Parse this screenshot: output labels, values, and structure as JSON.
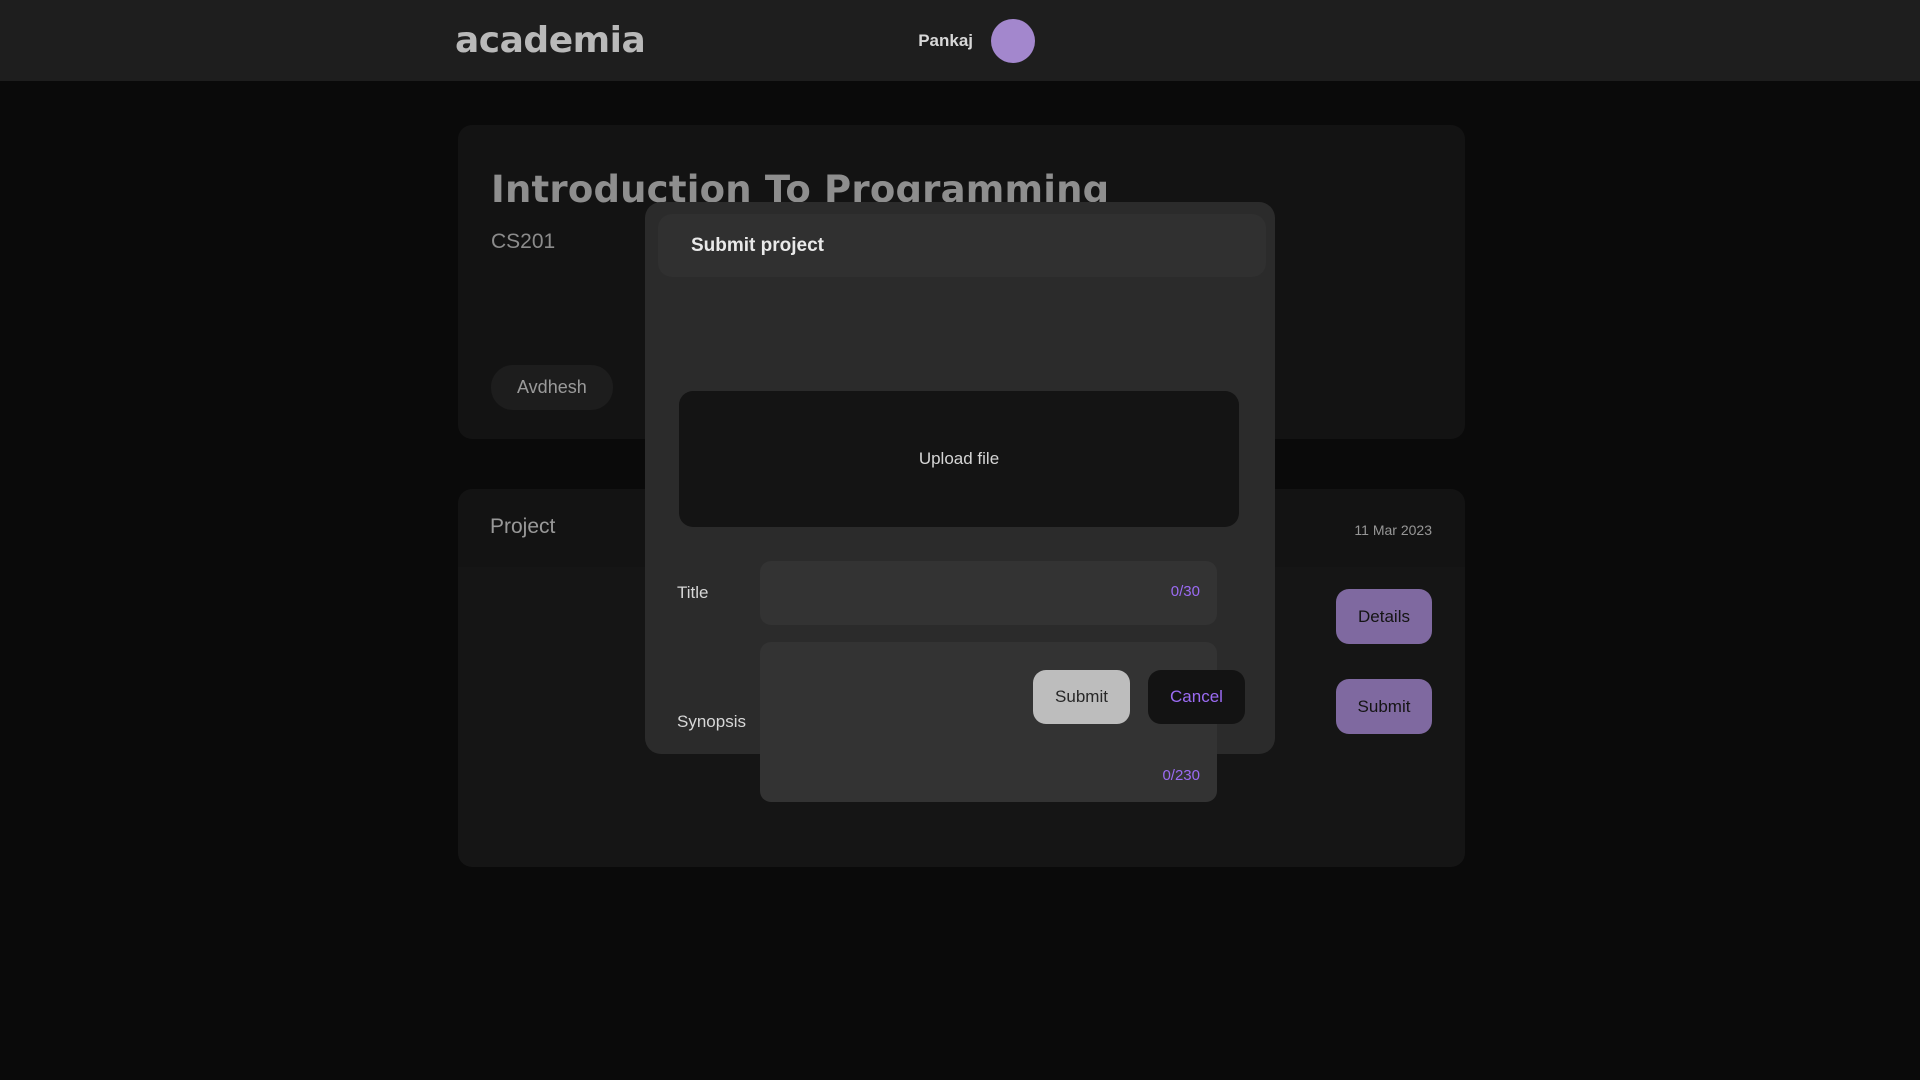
{
  "header": {
    "brand": "academia",
    "user_name": "Pankaj",
    "avatar_color": "#a387cd"
  },
  "course": {
    "title": "Introduction To Programming",
    "code": "CS201",
    "teacher": "Avdhesh"
  },
  "project_list": {
    "row_label": "Project",
    "date": "11 Mar 2023",
    "details_label": "Details",
    "submit_label": "Submit",
    "accent_color": "#a387cd"
  },
  "modal": {
    "title": "Submit project",
    "upload_label": "Upload file",
    "title_field": {
      "label": "Title",
      "value": "",
      "placeholder": "",
      "counter": "0/30"
    },
    "synopsis_field": {
      "label": "Synopsis",
      "value": "",
      "placeholder": "",
      "counter": "0/230"
    },
    "submit_label": "Submit",
    "cancel_label": "Cancel",
    "counter_color": "#9b6bf3"
  }
}
